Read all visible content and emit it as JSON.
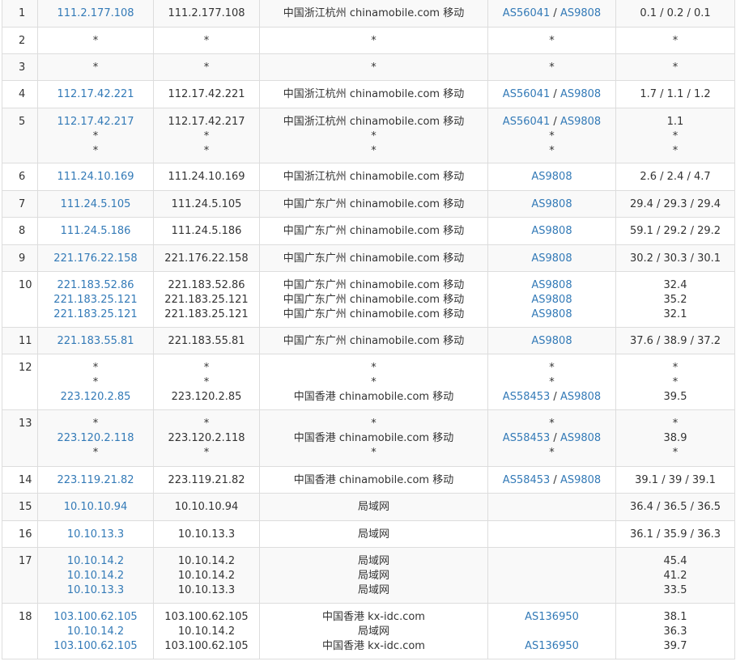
{
  "rows": [
    {
      "hop": "1",
      "lines": [
        {
          "ip": "111.2.177.108",
          "host": "111.2.177.108",
          "loc": "中国浙江杭州 chinamobile.com 移动",
          "asn": [
            "AS56041",
            "AS9808"
          ],
          "time": "0.1 / 0.2 / 0.1"
        }
      ]
    },
    {
      "hop": "2",
      "lines": [
        {
          "ip": "*",
          "host": "*",
          "loc": "*",
          "asn": [
            "*"
          ],
          "time": "*"
        }
      ]
    },
    {
      "hop": "3",
      "lines": [
        {
          "ip": "*",
          "host": "*",
          "loc": "*",
          "asn": [
            "*"
          ],
          "time": "*"
        }
      ]
    },
    {
      "hop": "4",
      "lines": [
        {
          "ip": "112.17.42.221",
          "host": "112.17.42.221",
          "loc": "中国浙江杭州 chinamobile.com 移动",
          "asn": [
            "AS56041",
            "AS9808"
          ],
          "time": "1.7 / 1.1 / 1.2"
        }
      ]
    },
    {
      "hop": "5",
      "lines": [
        {
          "ip": "112.17.42.217",
          "host": "112.17.42.217",
          "loc": "中国浙江杭州 chinamobile.com 移动",
          "asn": [
            "AS56041",
            "AS9808"
          ],
          "time": "1.1"
        },
        {
          "ip": "*",
          "host": "*",
          "loc": "*",
          "asn": [
            "*"
          ],
          "time": "*"
        },
        {
          "ip": "*",
          "host": "*",
          "loc": "*",
          "asn": [
            "*"
          ],
          "time": "*"
        }
      ]
    },
    {
      "hop": "6",
      "lines": [
        {
          "ip": "111.24.10.169",
          "host": "111.24.10.169",
          "loc": "中国浙江杭州 chinamobile.com 移动",
          "asn": [
            "AS9808"
          ],
          "time": "2.6 / 2.4 / 4.7"
        }
      ]
    },
    {
      "hop": "7",
      "lines": [
        {
          "ip": "111.24.5.105",
          "host": "111.24.5.105",
          "loc": "中国广东广州 chinamobile.com 移动",
          "asn": [
            "AS9808"
          ],
          "time": "29.4 / 29.3 / 29.4"
        }
      ]
    },
    {
      "hop": "8",
      "lines": [
        {
          "ip": "111.24.5.186",
          "host": "111.24.5.186",
          "loc": "中国广东广州 chinamobile.com 移动",
          "asn": [
            "AS9808"
          ],
          "time": "59.1 / 29.2 / 29.2"
        }
      ]
    },
    {
      "hop": "9",
      "lines": [
        {
          "ip": "221.176.22.158",
          "host": "221.176.22.158",
          "loc": "中国广东广州 chinamobile.com 移动",
          "asn": [
            "AS9808"
          ],
          "time": "30.2 / 30.3 / 30.1"
        }
      ]
    },
    {
      "hop": "10",
      "lines": [
        {
          "ip": "221.183.52.86",
          "host": "221.183.52.86",
          "loc": "中国广东广州 chinamobile.com 移动",
          "asn": [
            "AS9808"
          ],
          "time": "32.4"
        },
        {
          "ip": "221.183.25.121",
          "host": "221.183.25.121",
          "loc": "中国广东广州 chinamobile.com 移动",
          "asn": [
            "AS9808"
          ],
          "time": "35.2"
        },
        {
          "ip": "221.183.25.121",
          "host": "221.183.25.121",
          "loc": "中国广东广州 chinamobile.com 移动",
          "asn": [
            "AS9808"
          ],
          "time": "32.1"
        }
      ]
    },
    {
      "hop": "11",
      "lines": [
        {
          "ip": "221.183.55.81",
          "host": "221.183.55.81",
          "loc": "中国广东广州 chinamobile.com 移动",
          "asn": [
            "AS9808"
          ],
          "time": "37.6 / 38.9 / 37.2"
        }
      ]
    },
    {
      "hop": "12",
      "lines": [
        {
          "ip": "*",
          "host": "*",
          "loc": "*",
          "asn": [
            "*"
          ],
          "time": "*"
        },
        {
          "ip": "*",
          "host": "*",
          "loc": "*",
          "asn": [
            "*"
          ],
          "time": "*"
        },
        {
          "ip": "223.120.2.85",
          "host": "223.120.2.85",
          "loc": "中国香港 chinamobile.com 移动",
          "asn": [
            "AS58453",
            "AS9808"
          ],
          "time": "39.5"
        }
      ]
    },
    {
      "hop": "13",
      "lines": [
        {
          "ip": "*",
          "host": "*",
          "loc": "*",
          "asn": [
            "*"
          ],
          "time": "*"
        },
        {
          "ip": "223.120.2.118",
          "host": "223.120.2.118",
          "loc": "中国香港 chinamobile.com 移动",
          "asn": [
            "AS58453",
            "AS9808"
          ],
          "time": "38.9"
        },
        {
          "ip": "*",
          "host": "*",
          "loc": "*",
          "asn": [
            "*"
          ],
          "time": "*"
        }
      ]
    },
    {
      "hop": "14",
      "lines": [
        {
          "ip": "223.119.21.82",
          "host": "223.119.21.82",
          "loc": "中国香港 chinamobile.com 移动",
          "asn": [
            "AS58453",
            "AS9808"
          ],
          "time": "39.1 / 39 / 39.1"
        }
      ]
    },
    {
      "hop": "15",
      "lines": [
        {
          "ip": "10.10.10.94",
          "host": "10.10.10.94",
          "loc": "局域网",
          "asn": [],
          "time": "36.4 / 36.5 / 36.5"
        }
      ]
    },
    {
      "hop": "16",
      "lines": [
        {
          "ip": "10.10.13.3",
          "host": "10.10.13.3",
          "loc": "局域网",
          "asn": [],
          "time": "36.1 / 35.9 / 36.3"
        }
      ]
    },
    {
      "hop": "17",
      "lines": [
        {
          "ip": "10.10.14.2",
          "host": "10.10.14.2",
          "loc": "局域网",
          "asn": [],
          "time": "45.4"
        },
        {
          "ip": "10.10.14.2",
          "host": "10.10.14.2",
          "loc": "局域网",
          "asn": [],
          "time": "41.2"
        },
        {
          "ip": "10.10.13.3",
          "host": "10.10.13.3",
          "loc": "局域网",
          "asn": [],
          "time": "33.5"
        }
      ]
    },
    {
      "hop": "18",
      "lines": [
        {
          "ip": "103.100.62.105",
          "host": "103.100.62.105",
          "loc": "中国香港 kx-idc.com",
          "asn": [
            "AS136950"
          ],
          "time": "38.1"
        },
        {
          "ip": "10.10.14.2",
          "host": "10.10.14.2",
          "loc": "局域网",
          "asn": [],
          "time": "36.3"
        },
        {
          "ip": "103.100.62.105",
          "host": "103.100.62.105",
          "loc": "中国香港 kx-idc.com",
          "asn": [
            "AS136950"
          ],
          "time": "39.7"
        }
      ]
    }
  ],
  "colors": {
    "link": "#337ab7",
    "text": "#333333",
    "border": "#dddddd",
    "stripe": "#f9f9f9"
  }
}
